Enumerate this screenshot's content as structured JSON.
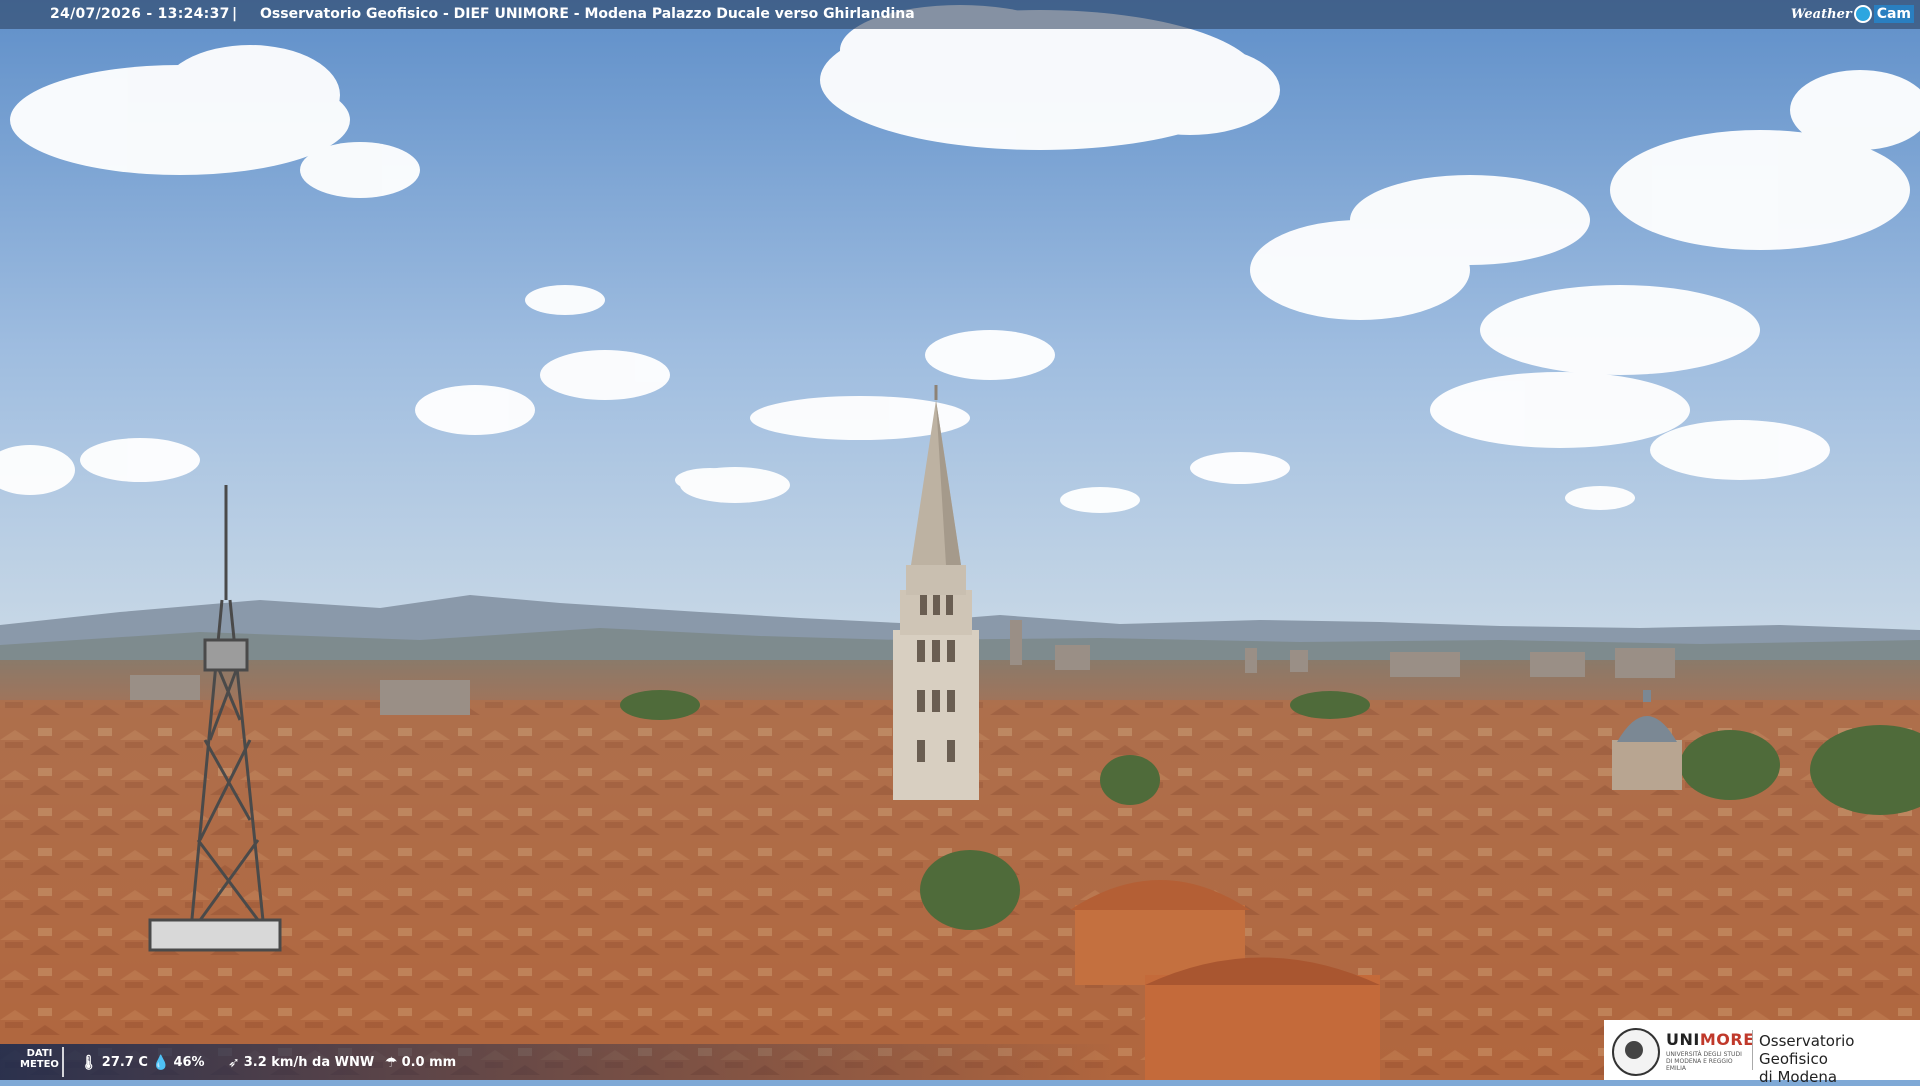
{
  "overlay": {
    "datetime": "24/07/2026 - 13:24:37",
    "separator": "|",
    "title": "Osservatorio Geofisico - DIEF UNIMORE - Modena Palazzo Ducale verso Ghirlandina"
  },
  "brand": {
    "weather": "Weather",
    "cam": "Cam",
    "colors": {
      "accent": "#2a7fc0",
      "dot": "#2da6e0"
    }
  },
  "meteo": {
    "label_line1": "DATI",
    "label_line2": "METEO",
    "temperature": "27.7 C",
    "humidity": "46%",
    "wind": "3.2 km/h da WNW",
    "rain": "0.0 mm",
    "icons": [
      "thermometer-icon",
      "humidity-drop-icon",
      "wind-icon",
      "rain-icon"
    ]
  },
  "partner_logo": {
    "uni_prefix": "UNI",
    "uni_suffix": "MORE",
    "uni_subtitle": "UNIVERSITÀ DEGLI STUDI DI MODENA E REGGIO EMILIA",
    "observatory_line1": "Osservatorio Geofisico",
    "observatory_line2": "di Modena"
  },
  "colors": {
    "sky_top": "#5f8fc9",
    "sky_bottom": "#b9cfe3",
    "roofs": "#b86f45"
  }
}
